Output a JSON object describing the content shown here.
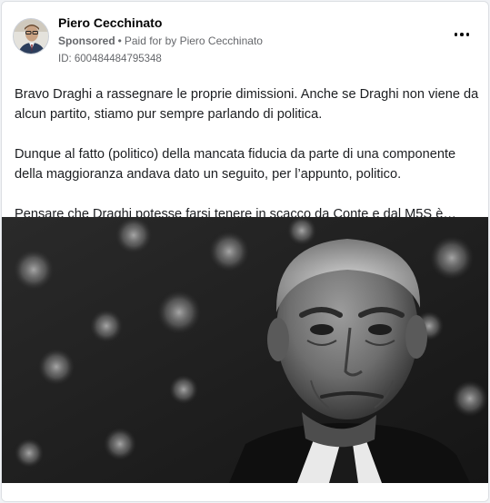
{
  "post": {
    "author": "Piero Cecchinato",
    "sponsored_label": "Sponsored",
    "separator": "•",
    "paid_for_label": "Paid for by Piero Cecchinato",
    "ad_id": "ID: 600484484795348",
    "more_icon": "more-options-icon",
    "paragraphs": [
      "Bravo Draghi a rassegnare le proprie dimissioni. Anche se Draghi non viene da alcun partito, stiamo pur sempre parlando di politica.",
      "Dunque al fatto (politico) della mancata fiducia da parte di una componente della maggioranza andava dato un seguito, per l’appunto, politico.",
      "Pensare che Draghi potesse farsi tenere in scacco da Conte e dal M5S è…"
    ]
  },
  "colors": {
    "card_bg": "#ffffff",
    "page_bg": "#f0f2f5",
    "secondary_text": "#65676b",
    "primary_text": "#050505"
  }
}
